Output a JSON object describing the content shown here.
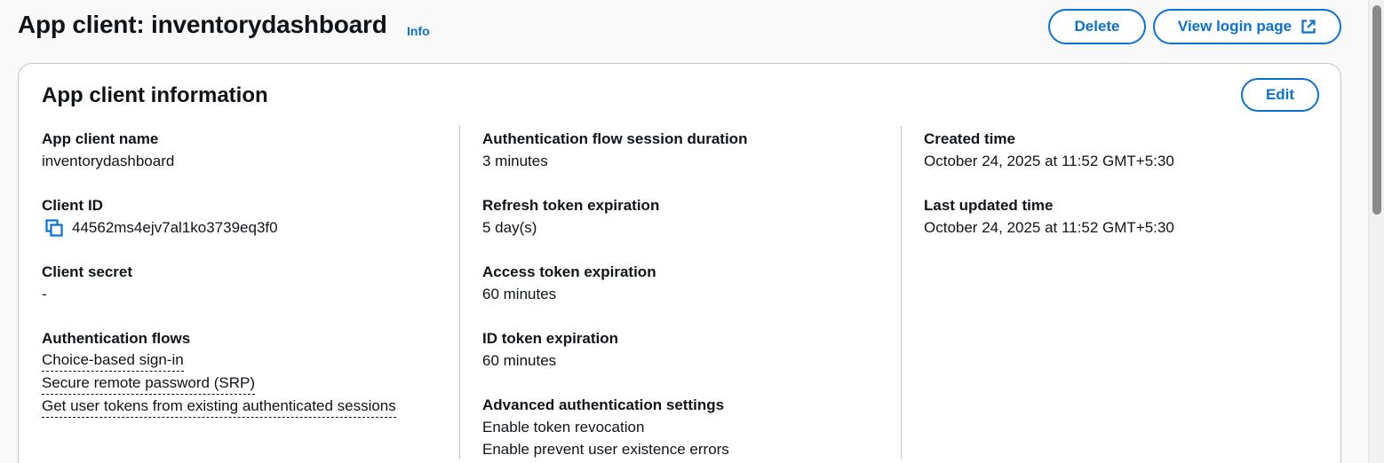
{
  "header": {
    "title": "App client: inventorydashboard",
    "info_label": "Info",
    "delete_label": "Delete",
    "view_login_label": "View login page"
  },
  "card": {
    "title": "App client information",
    "edit_label": "Edit"
  },
  "col1": {
    "app_client_name": {
      "label": "App client name",
      "value": "inventorydashboard"
    },
    "client_id": {
      "label": "Client ID",
      "value": "44562ms4ejv7al1ko3739eq3f0"
    },
    "client_secret": {
      "label": "Client secret",
      "value": "-"
    },
    "auth_flows": {
      "label": "Authentication flows",
      "items": [
        "Choice-based sign-in",
        "Secure remote password (SRP)",
        "Get user tokens from existing authenticated sessions"
      ]
    }
  },
  "col2": {
    "session_duration": {
      "label": "Authentication flow session duration",
      "value": "3 minutes"
    },
    "refresh_token": {
      "label": "Refresh token expiration",
      "value": "5 day(s)"
    },
    "access_token": {
      "label": "Access token expiration",
      "value": "60 minutes"
    },
    "id_token": {
      "label": "ID token expiration",
      "value": "60 minutes"
    },
    "advanced": {
      "label": "Advanced authentication settings",
      "values": [
        "Enable token revocation",
        "Enable prevent user existence errors"
      ]
    }
  },
  "col3": {
    "created": {
      "label": "Created time",
      "value": "October 24, 2025 at 11:52 GMT+5:30"
    },
    "updated": {
      "label": "Last updated time",
      "value": "October 24, 2025 at 11:52 GMT+5:30"
    }
  },
  "icons": {
    "copy": "copy-icon",
    "external": "external-link-icon"
  },
  "colors": {
    "accent": "#0972d3",
    "text": "#0f141a",
    "border": "#c6c6cd"
  }
}
